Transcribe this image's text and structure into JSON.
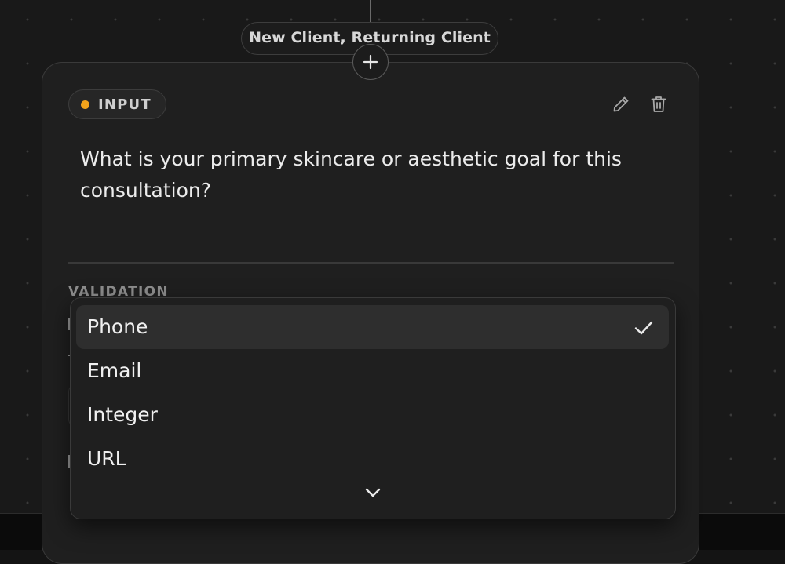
{
  "canvas": {
    "edge_label": "New Client, Returning Client",
    "add_node_icon": "plus-icon"
  },
  "node": {
    "type_badge": {
      "label": "INPUT",
      "dot_color": "#f2a31b"
    },
    "actions": {
      "edit_icon": "pencil-icon",
      "delete_icon": "trash-icon"
    },
    "question": "What is your primary skincare or aesthetic goal for this consultation?",
    "validation": {
      "section_title": "VALIDATION"
    }
  },
  "dropdown": {
    "selected": "Phone",
    "options": [
      {
        "label": "Phone",
        "selected": true
      },
      {
        "label": "Email",
        "selected": false
      },
      {
        "label": "Integer",
        "selected": false
      },
      {
        "label": "URL",
        "selected": false
      }
    ],
    "check_icon": "check-icon",
    "scroll_icon": "chevron-down-icon"
  }
}
